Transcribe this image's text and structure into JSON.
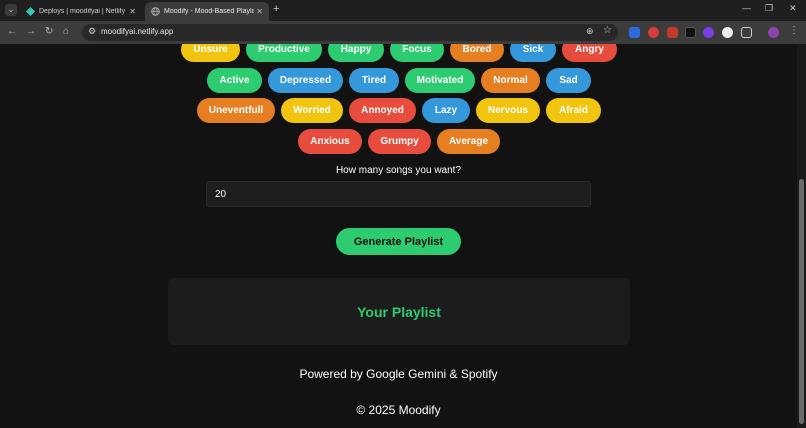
{
  "browser": {
    "tabs": [
      {
        "title": "Deploys | moodifyai | Netlify",
        "active": false,
        "icon": "netlify-diamond-icon",
        "icon_color": "#32c7b7"
      },
      {
        "title": "Moodify - Mood-Based Playlist",
        "active": true,
        "icon": "globe-icon"
      }
    ],
    "url": "moodifyai.netlify.app",
    "icons": {
      "new_tab": "+",
      "minimize": "—",
      "restore": "❐",
      "close": "✕",
      "tab_close": "✕"
    }
  },
  "moods": [
    {
      "label": "Unsure",
      "color": "yellow"
    },
    {
      "label": "Productive",
      "color": "green"
    },
    {
      "label": "Happy",
      "color": "green"
    },
    {
      "label": "Focus",
      "color": "green"
    },
    {
      "label": "Bored",
      "color": "orange"
    },
    {
      "label": "Sick",
      "color": "blue"
    },
    {
      "label": "Angry",
      "color": "red"
    },
    {
      "label": "Active",
      "color": "green"
    },
    {
      "label": "Depressed",
      "color": "blue"
    },
    {
      "label": "Tired",
      "color": "blue"
    },
    {
      "label": "Motivated",
      "color": "green"
    },
    {
      "label": "Normal",
      "color": "orange"
    },
    {
      "label": "Sad",
      "color": "blue"
    },
    {
      "label": "Uneventfull",
      "color": "orange"
    },
    {
      "label": "Worried",
      "color": "yellow"
    },
    {
      "label": "Annoyed",
      "color": "red"
    },
    {
      "label": "Lazy",
      "color": "blue"
    },
    {
      "label": "Nervous",
      "color": "yellow"
    },
    {
      "label": "Afraid",
      "color": "yellow"
    },
    {
      "label": "Anxious",
      "color": "red"
    },
    {
      "label": "Grumpy",
      "color": "red"
    },
    {
      "label": "Average",
      "color": "orange"
    }
  ],
  "colors": {
    "yellow": "#f1c40f",
    "green": "#2ecc71",
    "orange": "#e67e22",
    "blue": "#3498db",
    "red": "#e74c3c"
  },
  "form": {
    "question": "How many songs you want?",
    "songs_value": "20",
    "generate_label": "Generate Playlist"
  },
  "playlist": {
    "title": "Your Playlist"
  },
  "footer": {
    "powered": "Powered by Google Gemini & Spotify",
    "copyright": "© 2025 Moodify"
  }
}
